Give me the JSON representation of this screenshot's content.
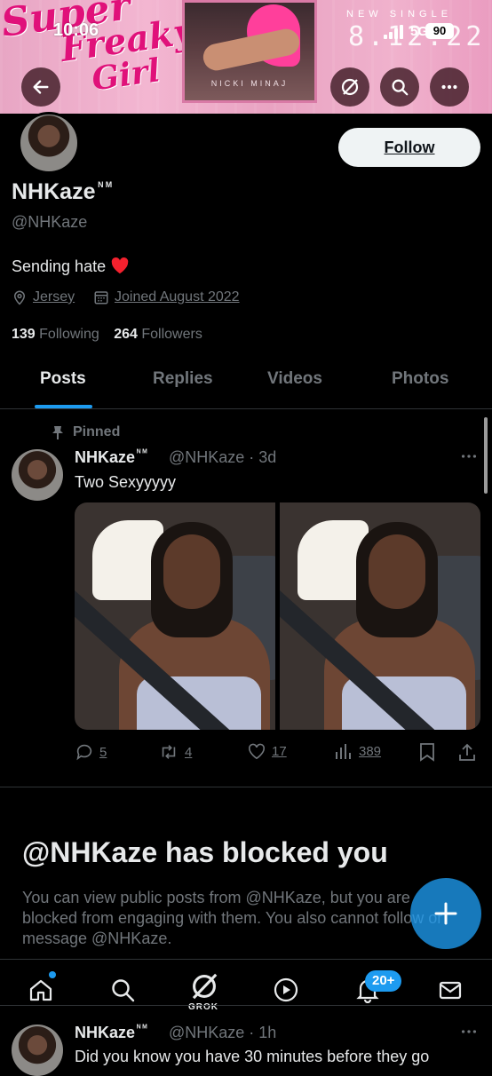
{
  "status_bar": {
    "time": "10:06",
    "network": "5G",
    "battery": "90"
  },
  "banner": {
    "script_line1": "Super",
    "script_line2": "Freaky",
    "script_line3": "Girl",
    "album_artist": "NICKI MINAJ",
    "tagline": "NEW SINGLE",
    "date": "8.12.22"
  },
  "profile": {
    "follow_label": "Follow",
    "display_name": "NHKaze",
    "name_suffix": "ᴺᴹ",
    "handle": "@NHKaze",
    "bio": "Sending hate",
    "location": "Jersey",
    "joined": "Joined August 2022",
    "following_count": "139",
    "following_label": "Following",
    "followers_count": "264",
    "followers_label": "Followers"
  },
  "tabs": [
    {
      "label": "Posts"
    },
    {
      "label": "Replies"
    },
    {
      "label": "Videos"
    },
    {
      "label": "Photos"
    }
  ],
  "pinned_post": {
    "pinned_label": "Pinned",
    "name": "NHKaze",
    "name_suffix": "ᴺᴹ",
    "handle_time": "@NHKaze · 3d",
    "text": "Two Sexyyyyy",
    "replies": "5",
    "reposts": "4",
    "likes": "17",
    "views": "389"
  },
  "blocked": {
    "title": "@NHKaze has blocked you",
    "body": "You can view public posts from @NHKaze, but you are blocked from engaging with them. You also cannot follow or message @NHKaze."
  },
  "bottom_nav": {
    "grok_label": "GROK",
    "notification_badge": "20+"
  },
  "next_post": {
    "name": "NHKaze",
    "name_suffix": "ᴺᴹ",
    "handle_time": "@NHKaze · 1h",
    "text": "Did you know you have 30 minutes before they go"
  },
  "colors": {
    "accent": "#1d9bf0",
    "background": "#000000",
    "secondary_text": "#71767b",
    "heart": "#f4212e"
  }
}
